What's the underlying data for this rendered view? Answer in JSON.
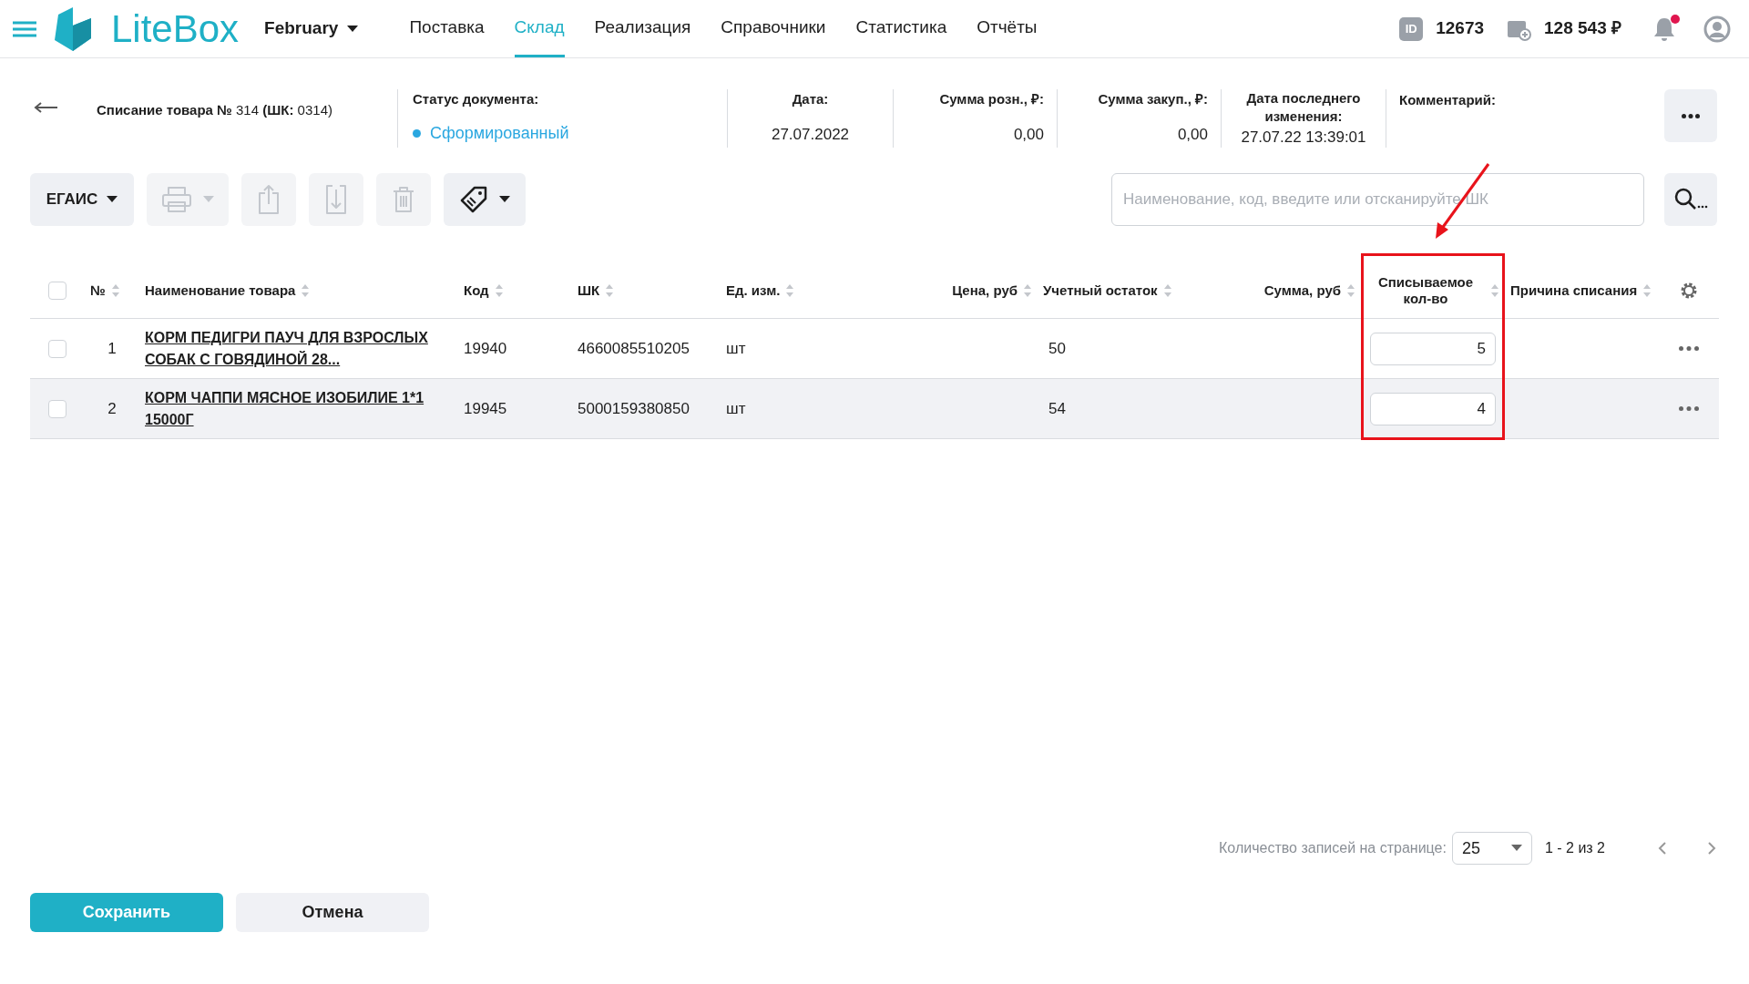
{
  "header": {
    "brand": "LiteBox",
    "month": "February",
    "nav": [
      {
        "label": "Поставка",
        "selected": false
      },
      {
        "label": "Склад",
        "selected": true
      },
      {
        "label": "Реализация",
        "selected": false
      },
      {
        "label": "Справочники",
        "selected": false
      },
      {
        "label": "Статистика",
        "selected": false
      },
      {
        "label": "Отчёты",
        "selected": false
      }
    ],
    "id_icon_text": "ID",
    "id": "12673",
    "balance": "128 543 ₽",
    "has_notifications": true
  },
  "document": {
    "title": "**Списание товара №** 314 **(ШК:** 0314)",
    "status_label": "Статус документа:",
    "status": "Сформированный",
    "date_label": "Дата:",
    "date": "27.07.2022",
    "retail_label": "Сумма розн., ₽:",
    "retail": "0,00",
    "purchase_label": "Сумма закуп., ₽:",
    "purchase": "0,00",
    "changed_label": "Дата последнего изменения:",
    "changed": "27.07.22 13:39:01",
    "comment_label": "Комментарий:"
  },
  "toolbar": {
    "egais": "ЕГАИС",
    "buttons": [
      {
        "kind": "print",
        "disabled": true
      },
      {
        "kind": "export",
        "disabled": true
      },
      {
        "kind": "import",
        "disabled": true
      },
      {
        "kind": "delete",
        "disabled": true
      },
      {
        "kind": "tag",
        "disabled": false
      }
    ],
    "search_placeholder": "Наименование, код, введите или отсканируйте ШК"
  },
  "table": {
    "all_checked": false,
    "columns": [
      {
        "label": "№",
        "highlighted": false
      },
      {
        "label": "Наименование товара",
        "highlighted": false
      },
      {
        "label": "Код",
        "highlighted": false
      },
      {
        "label": "ШК",
        "highlighted": false
      },
      {
        "label": "Ед. изм.",
        "highlighted": false
      },
      {
        "label": "Цена, руб",
        "highlighted": false
      },
      {
        "label": "Учетный остаток",
        "highlighted": false
      },
      {
        "label": "Сумма, руб",
        "highlighted": false
      },
      {
        "label": "Списываемое кол-во",
        "highlighted": true
      },
      {
        "label": "Причина списания",
        "highlighted": false
      }
    ],
    "rows": [
      {
        "checked": false,
        "selected": false,
        "number": "1",
        "name": "КОРМ ПЕДИГРИ ПАУЧ ДЛЯ ВЗРОСЛЫХ СОБАК С ГОВЯДИНОЙ 28...",
        "code": "19940",
        "barcode": "4660085510205",
        "unit": "шт",
        "stock": "50",
        "quantity": "5"
      },
      {
        "checked": false,
        "selected": true,
        "number": "2",
        "name": "КОРМ ЧАППИ МЯСНОЕ ИЗОБИЛИЕ 1*1 15000Г",
        "code": "19945",
        "barcode": "5000159380850",
        "unit": "шт",
        "stock": "54",
        "quantity": "4"
      }
    ]
  },
  "pagination": {
    "label": "Количество записей на странице:",
    "per_page": "25",
    "range": "1 - 2 из 2"
  },
  "buttons": {
    "save": "Сохранить",
    "cancel": "Отмена"
  }
}
